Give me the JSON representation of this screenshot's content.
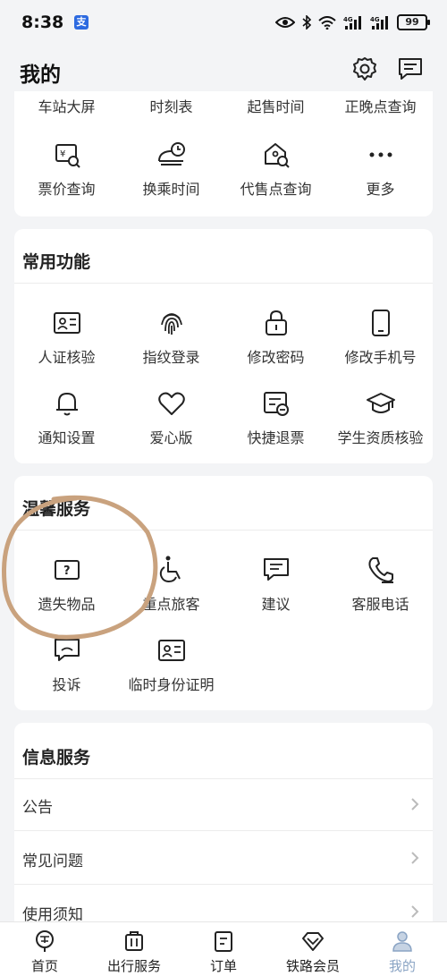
{
  "status_bar": {
    "time": "8:38",
    "app_badge": "支",
    "battery": "99"
  },
  "header": {
    "title": "我的"
  },
  "top_section": {
    "row1": [
      "车站大屏",
      "时刻表",
      "起售时间",
      "正晚点查询"
    ],
    "row2": [
      {
        "label": "票价查询",
        "icon": "ticket-price-search-icon"
      },
      {
        "label": "换乘时间",
        "icon": "train-clock-icon"
      },
      {
        "label": "代售点查询",
        "icon": "agency-search-icon"
      },
      {
        "label": "更多",
        "icon": "more-icon"
      }
    ]
  },
  "common": {
    "title": "常用功能",
    "items": [
      {
        "label": "人证核验",
        "icon": "id-card-icon"
      },
      {
        "label": "指纹登录",
        "icon": "fingerprint-icon"
      },
      {
        "label": "修改密码",
        "icon": "lock-icon"
      },
      {
        "label": "修改手机号",
        "icon": "phone-icon"
      },
      {
        "label": "通知设置",
        "icon": "bell-icon"
      },
      {
        "label": "爱心版",
        "icon": "heart-icon"
      },
      {
        "label": "快捷退票",
        "icon": "refund-ticket-icon"
      },
      {
        "label": "学生资质核验",
        "icon": "graduation-cap-icon"
      }
    ]
  },
  "warm": {
    "title": "温馨服务",
    "items": [
      {
        "label": "遗失物品",
        "icon": "lost-item-icon"
      },
      {
        "label": "重点旅客",
        "icon": "wheelchair-icon"
      },
      {
        "label": "建议",
        "icon": "suggestion-icon"
      },
      {
        "label": "客服电话",
        "icon": "phone-call-icon"
      },
      {
        "label": "投诉",
        "icon": "complaint-icon"
      },
      {
        "label": "临时身份证明",
        "icon": "temp-id-icon"
      }
    ]
  },
  "info": {
    "title": "信息服务",
    "rows": [
      "公告",
      "常见问题",
      "使用须知"
    ]
  },
  "tabbar": {
    "tabs": [
      {
        "label": "首页",
        "icon": "home-railway-icon"
      },
      {
        "label": "出行服务",
        "icon": "luggage-icon"
      },
      {
        "label": "订单",
        "icon": "order-icon"
      },
      {
        "label": "铁路会员",
        "icon": "member-diamond-icon"
      },
      {
        "label": "我的",
        "icon": "profile-icon"
      }
    ],
    "active_color": "#8aa4c4"
  },
  "colors": {
    "background": "#f3f4f6",
    "card": "#ffffff",
    "annotation": "#c9a27e"
  }
}
